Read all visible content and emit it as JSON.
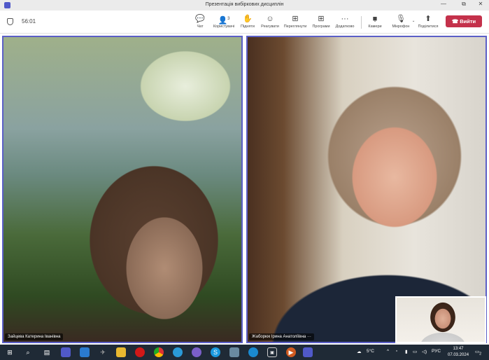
{
  "window": {
    "title": "Презентація вибіркових дисциплін",
    "minimize": "—",
    "maximize": "⧉",
    "close": "✕"
  },
  "toolbar": {
    "timer": "56:01",
    "participants_count": "3",
    "items": [
      {
        "label": "Чат",
        "icon": "chat-icon",
        "glyph": "💬"
      },
      {
        "label": "Користувачі",
        "icon": "people-icon",
        "glyph": "👤"
      },
      {
        "label": "Підняти",
        "icon": "raise-hand-icon",
        "glyph": "✋"
      },
      {
        "label": "Реагувати",
        "icon": "emoji-icon",
        "glyph": "☺"
      },
      {
        "label": "Переглянути",
        "icon": "view-grid-icon",
        "glyph": "⊞"
      },
      {
        "label": "Програми",
        "icon": "apps-icon",
        "glyph": "⊞"
      },
      {
        "label": "Додатково",
        "icon": "more-icon",
        "glyph": "···"
      },
      {
        "label": "Камери",
        "icon": "camera-icon",
        "glyph": "■"
      },
      {
        "label": "Мікрофон",
        "icon": "microphone-icon",
        "glyph": "🎙"
      },
      {
        "label": "Поділитися",
        "icon": "share-icon",
        "glyph": "⬆"
      }
    ],
    "leave_label": "Вийти",
    "leave_color": "#c4314b"
  },
  "participants": [
    {
      "name": "Зайцева Катерина Іванівна"
    },
    {
      "name": "Жаборюк Ірина Анатоліївна",
      "more": "···"
    }
  ],
  "accent": "#5b5fc7",
  "taskbar": {
    "weather": "5°C",
    "language": "РУС",
    "time": "13:47",
    "date": "07.03.2024",
    "notifications": "2"
  }
}
